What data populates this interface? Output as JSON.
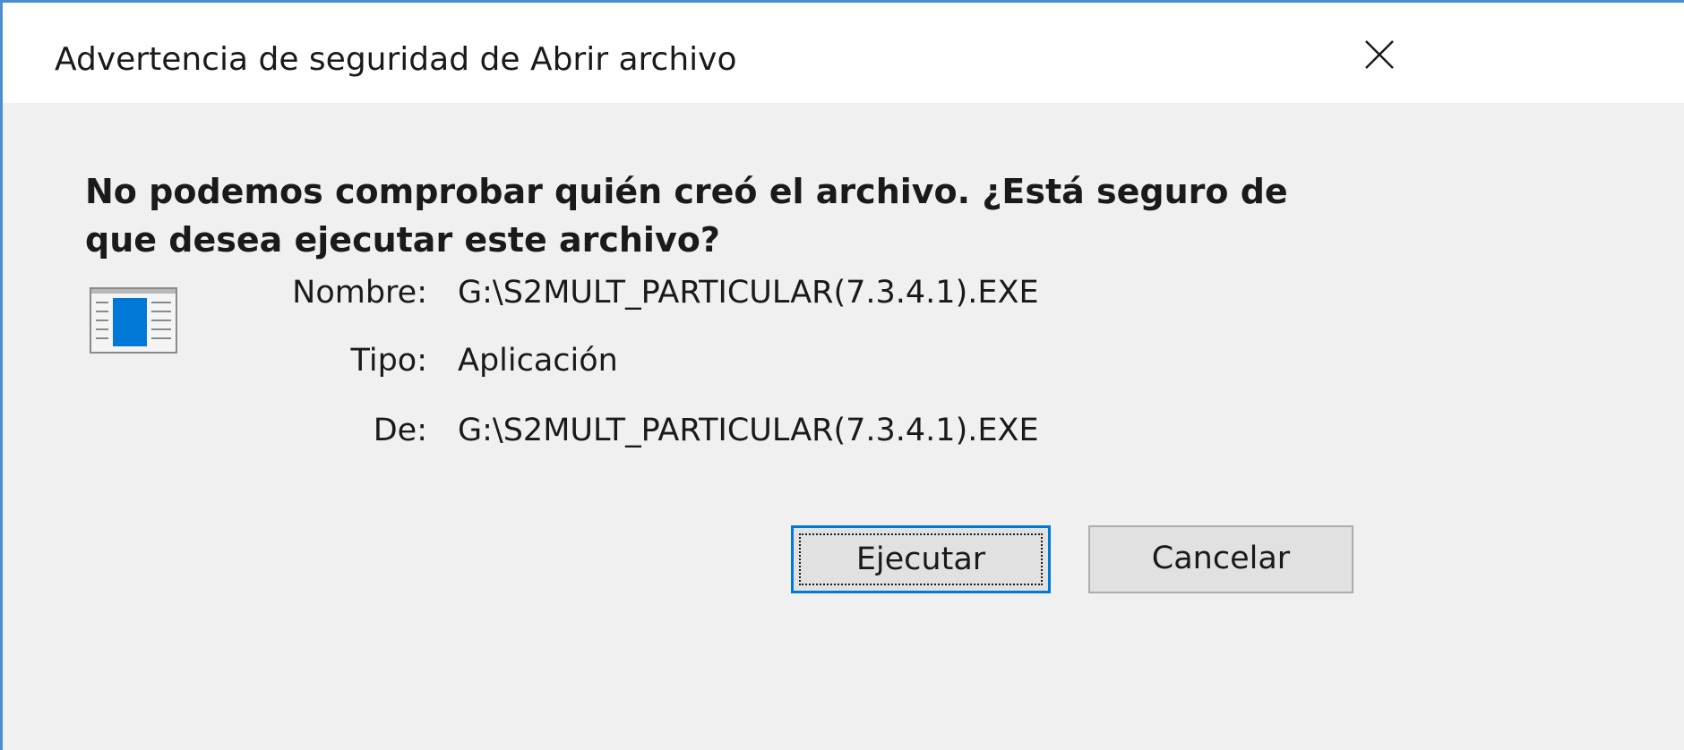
{
  "dialog": {
    "title": "Advertencia de seguridad de Abrir archivo",
    "close_icon": "close-icon",
    "headline": "No podemos comprobar quién creó el archivo. ¿Está seguro de que desea ejecutar este archivo?",
    "file_icon": "application-window-icon",
    "fields": {
      "name_label": "Nombre:",
      "name_value": "G:\\S2MULT_PARTICULAR(7.3.4.1).EXE",
      "type_label": "Tipo:",
      "type_value": "Aplicación",
      "from_label": "De:",
      "from_value": "G:\\S2MULT_PARTICULAR(7.3.4.1).EXE"
    },
    "buttons": {
      "run_label": "Ejecutar",
      "cancel_label": "Cancelar"
    }
  },
  "colors": {
    "window_border": "#4a8fd4",
    "titlebar_bg": "#ffffff",
    "content_bg": "#f0f0f0",
    "icon_blue": "#0078d7",
    "focus_border": "#0078d7"
  }
}
